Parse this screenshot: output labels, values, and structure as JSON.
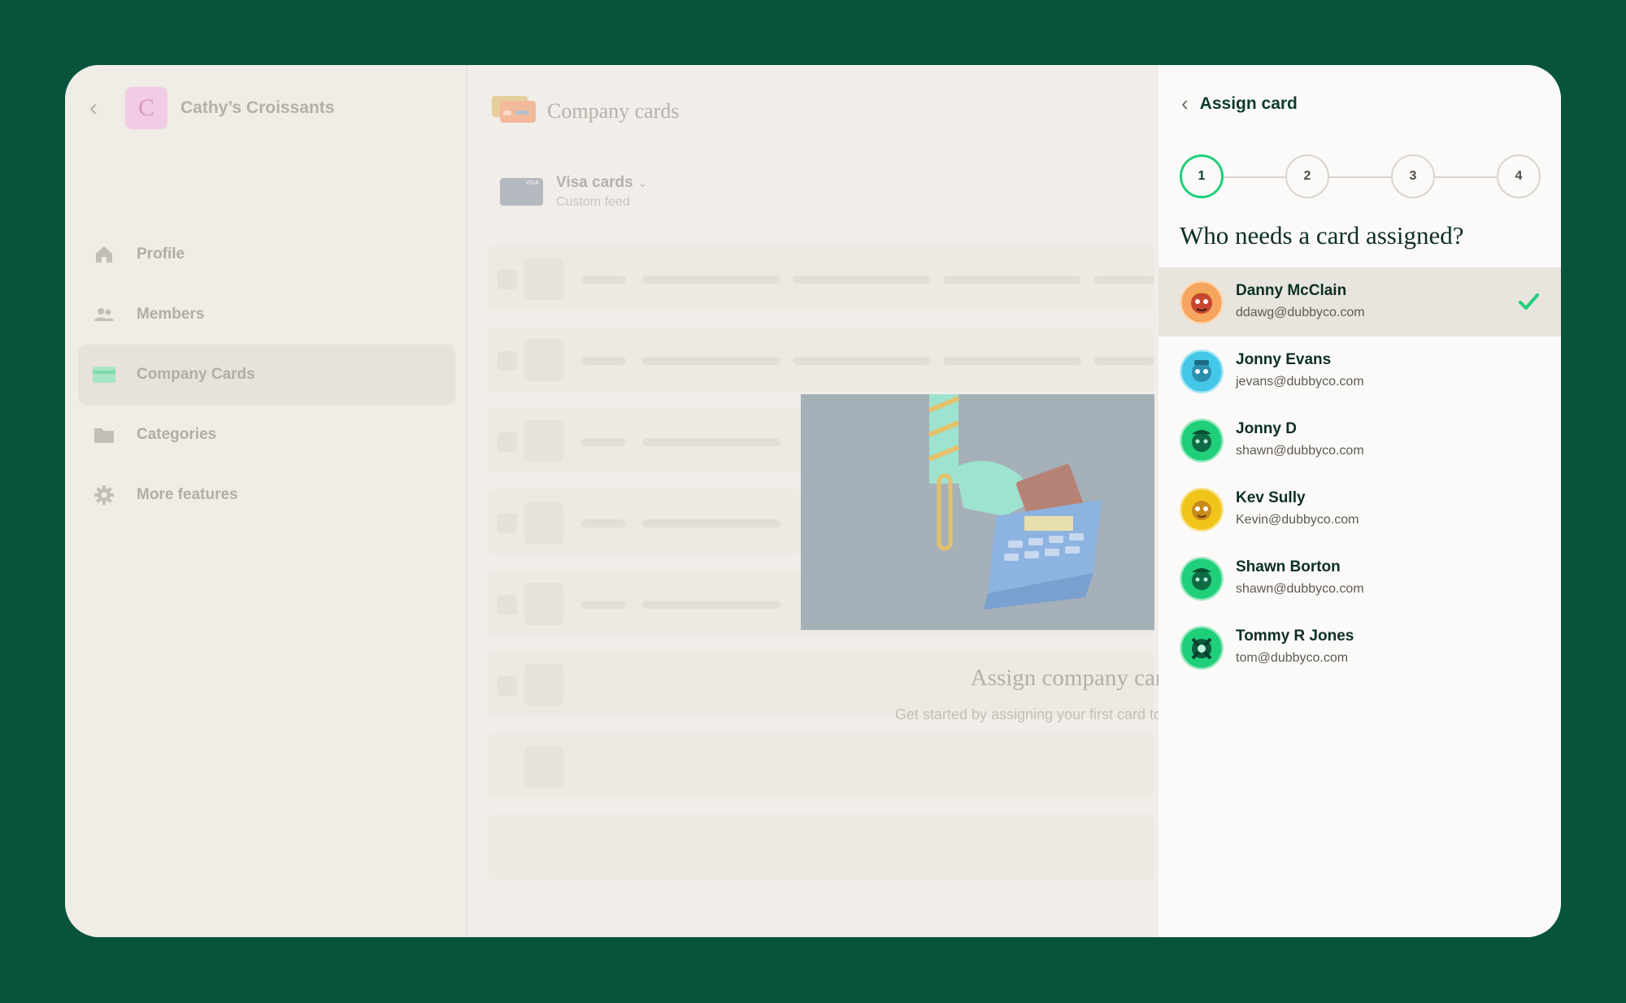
{
  "workspace": {
    "name": "Cathy’s Croissants",
    "avatar_letter": "C"
  },
  "sidebar": {
    "items": [
      {
        "label": "Profile",
        "icon": "home-icon"
      },
      {
        "label": "Members",
        "icon": "users-icon"
      },
      {
        "label": "Company Cards",
        "icon": "credit-card-icon",
        "active": true
      },
      {
        "label": "Categories",
        "icon": "folder-icon"
      },
      {
        "label": "More features",
        "icon": "gear-icon"
      }
    ]
  },
  "main": {
    "title": "Company cards",
    "feed": {
      "name": "Visa cards",
      "subtitle": "Custom feed",
      "card_brand": "VISA"
    },
    "empty_state": {
      "title": "Assign company cards",
      "description": "Get started by assigning your first card to a member."
    }
  },
  "panel": {
    "title": "Assign card",
    "steps": [
      "1",
      "2",
      "3",
      "4"
    ],
    "current_step": 1,
    "question": "Who needs a card assigned?",
    "members": [
      {
        "name": "Danny McClain",
        "email": "ddawg@dubbyco.com",
        "avatar_color": "#f6a55e",
        "selected": true
      },
      {
        "name": "Jonny Evans",
        "email": "jevans@dubbyco.com",
        "avatar_color": "#45c8e8"
      },
      {
        "name": "Jonny D",
        "email": "shawn@dubbyco.com",
        "avatar_color": "#1fcf7a"
      },
      {
        "name": "Kev Sully",
        "email": "Kevin@dubbyco.com",
        "avatar_color": "#f1c419"
      },
      {
        "name": "Shawn Borton",
        "email": "shawn@dubbyco.com",
        "avatar_color": "#1fcf7a"
      },
      {
        "name": "Tommy R Jones",
        "email": "tom@dubbyco.com",
        "avatar_color": "#1fcf7a"
      }
    ]
  },
  "colors": {
    "background": "#08533b",
    "accent": "#1fcf7a",
    "text_dark": "#0d2f24"
  }
}
